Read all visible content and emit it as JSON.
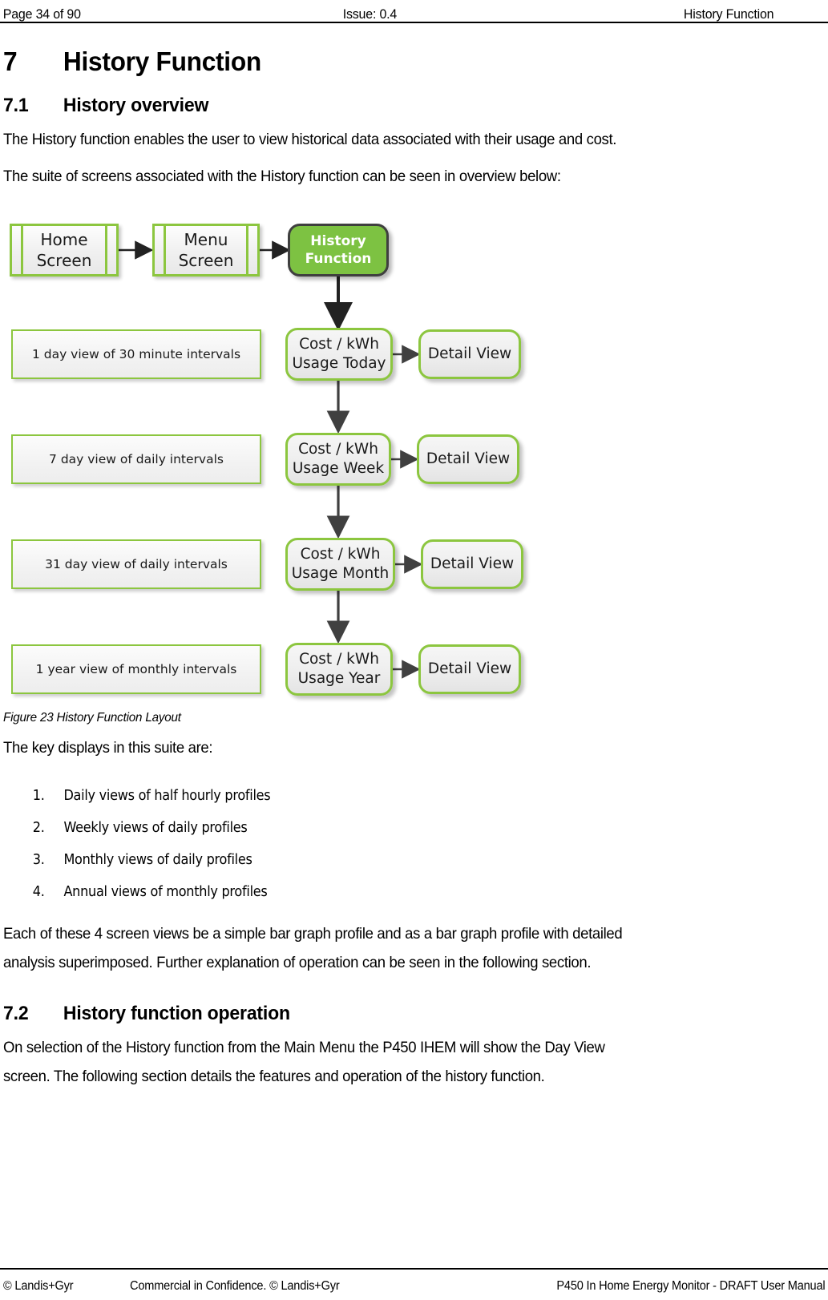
{
  "header": {
    "left": "Page 34 of 90",
    "center": "Issue: 0.4",
    "right": "History Function"
  },
  "section7": {
    "number": "7",
    "title": "History Function"
  },
  "section71": {
    "number": "7.1",
    "title": "History overview",
    "para1": "The History function enables the user to view historical data associated with their usage and cost.",
    "para2": "The suite of screens associated with the History function can be seen in overview below:"
  },
  "figure": {
    "caption": "Figure 23 History Function Layout",
    "nodes": {
      "home_screen": "Home\nScreen",
      "menu_screen": "Menu\nScreen",
      "history_function": "History\nFunction",
      "cost_today": "Cost / kWh\nUsage Today",
      "cost_week": "Cost / kWh\nUsage Week",
      "cost_month": "Cost / kWh\nUsage Month",
      "cost_year": "Cost / kWh\nUsage Year",
      "detail_today": "Detail View",
      "detail_week": "Detail View",
      "detail_month": "Detail View",
      "detail_year": "Detail View",
      "note_day": "1 day view of 30 minute intervals",
      "note_week": "7 day view of daily intervals",
      "note_month": "31 day view of daily intervals",
      "note_year": "1 year view of monthly intervals"
    },
    "colors": {
      "accent_green": "#8CC63F",
      "hero_fill": "#7DC242",
      "hero_border": "#3f3f3f",
      "arrow": "#404040"
    }
  },
  "keydisplays": {
    "intro": "The key displays in this suite are:",
    "items": [
      {
        "num": "1.",
        "text": "Daily views of half hourly profiles"
      },
      {
        "num": "2.",
        "text": "Weekly views of daily profiles"
      },
      {
        "num": "3.",
        "text": "Monthly views of daily profiles"
      },
      {
        "num": "4.",
        "text": "Annual views of monthly profiles"
      }
    ],
    "outro_line1": "Each of these 4 screen views be a simple bar graph profile and as a bar graph profile with detailed",
    "outro_line2": "analysis superimposed. Further explanation of operation can be seen in the following section."
  },
  "section72": {
    "number": "7.2",
    "title": "History function operation",
    "para_line1": "On selection of the History function from the Main Menu the P450 IHEM will show the Day View",
    "para_line2": "screen. The following section details the features and operation of the history function."
  },
  "footer": {
    "left": "© Landis+Gyr",
    "center": "Commercial in Confidence. © Landis+Gyr",
    "right": "P450 In Home Energy Monitor - DRAFT User Manual"
  }
}
